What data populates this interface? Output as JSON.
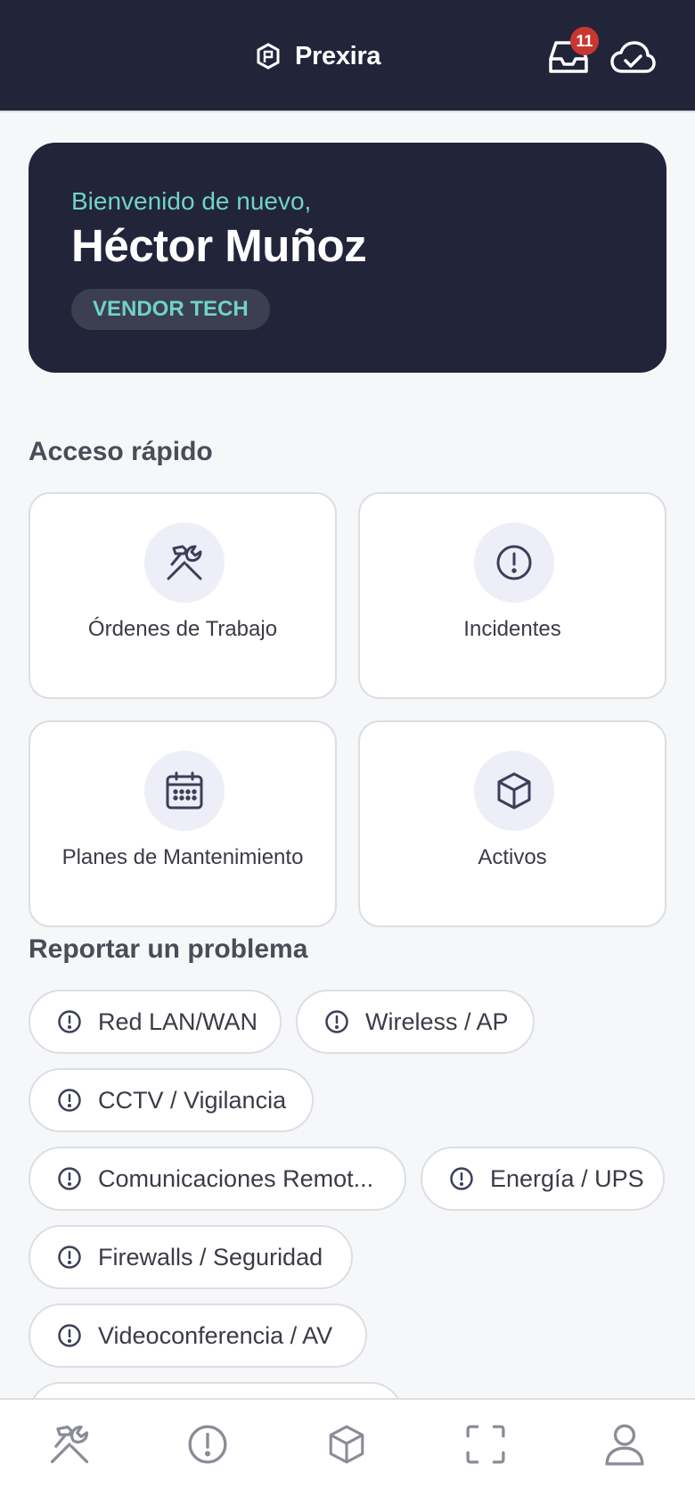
{
  "header": {
    "app_name": "Prexira",
    "notification_count": "11",
    "icons": [
      "prexira-logo-icon",
      "inbox-icon",
      "cloud-check-icon"
    ]
  },
  "welcome": {
    "greeting": "Bienvenido de nuevo,",
    "user_name": "Héctor Muñoz",
    "role": "VENDOR TECH"
  },
  "quick_access": {
    "title": "Acceso rápido",
    "cards": [
      {
        "label": "Órdenes de Trabajo",
        "icon": "tools-icon"
      },
      {
        "label": "Incidentes",
        "icon": "alert-circle-icon"
      },
      {
        "label": "Planes de Mantenimiento",
        "icon": "calendar-icon"
      },
      {
        "label": "Activos",
        "icon": "box-icon"
      }
    ]
  },
  "report": {
    "title": "Reportar un problema",
    "chips": [
      {
        "label": "Red LAN/WAN",
        "icon": "alert-circle-icon"
      },
      {
        "label": "Wireless / AP",
        "icon": "alert-circle-icon"
      },
      {
        "label": "CCTV / Vigilancia",
        "icon": "alert-circle-icon"
      },
      {
        "label": "Comunicaciones Remot...",
        "icon": "alert-circle-icon"
      },
      {
        "label": "Energía / UPS",
        "icon": "alert-circle-icon"
      },
      {
        "label": "Firewalls / Seguridad",
        "icon": "alert-circle-icon"
      },
      {
        "label": "Videoconferencia / AV",
        "icon": "alert-circle-icon"
      }
    ]
  },
  "bottom_nav": {
    "items": [
      "tools-icon",
      "alert-circle-icon",
      "box-icon",
      "scan-icon",
      "user-icon"
    ]
  },
  "colors": {
    "header_bg": "#22243a",
    "accent_teal": "#6fd3c8",
    "badge_red": "#c8372f",
    "icon_color": "#3d3f5a",
    "icon_bg": "#eeeef8"
  }
}
